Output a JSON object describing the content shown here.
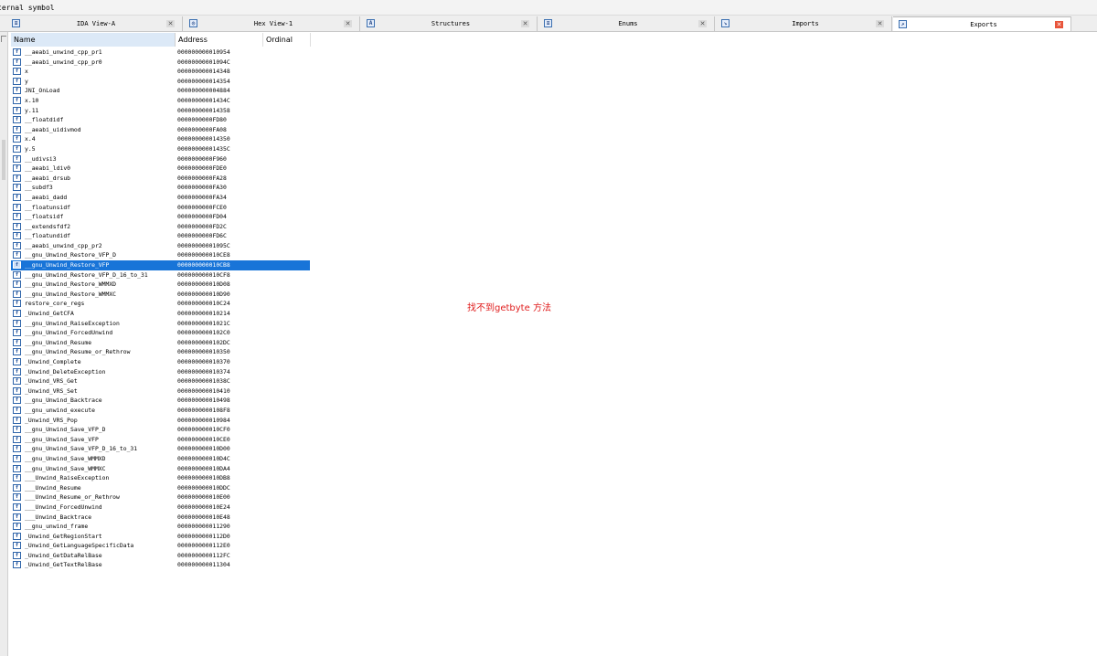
{
  "status": {
    "text": "ternal symbol"
  },
  "tabs": [
    {
      "label": "IDA View-A",
      "icon": "ida-view-icon",
      "active": false
    },
    {
      "label": "Hex View-1",
      "icon": "hex-view-icon",
      "active": false
    },
    {
      "label": "Structures",
      "icon": "structures-icon",
      "active": false
    },
    {
      "label": "Enums",
      "icon": "enums-icon",
      "active": false
    },
    {
      "label": "Imports",
      "icon": "imports-icon",
      "active": false
    },
    {
      "label": "Exports",
      "icon": "exports-icon",
      "active": true
    }
  ],
  "table": {
    "columns": {
      "name": "Name",
      "address": "Address",
      "ordinal": "Ordinal"
    },
    "selected_index": 22,
    "rows": [
      {
        "name": "__aeabi_unwind_cpp_pr1",
        "address": "000000000010954"
      },
      {
        "name": "__aeabi_unwind_cpp_pr0",
        "address": "00000000001094C"
      },
      {
        "name": "x",
        "address": "000000000014348"
      },
      {
        "name": "y",
        "address": "000000000014354"
      },
      {
        "name": "JNI_OnLoad",
        "address": "000000000004884"
      },
      {
        "name": "x.10",
        "address": "00000000001434C"
      },
      {
        "name": "y.11",
        "address": "000000000014358"
      },
      {
        "name": "__floatdidf",
        "address": "0000000000FD80"
      },
      {
        "name": "__aeabi_uidivmod",
        "address": "0000000000FA08"
      },
      {
        "name": "x.4",
        "address": "000000000014350"
      },
      {
        "name": "y.5",
        "address": "00000000001435C"
      },
      {
        "name": "__udivsi3",
        "address": "0000000000F960"
      },
      {
        "name": "__aeabi_ldiv0",
        "address": "0000000000FDE0"
      },
      {
        "name": "__aeabi_drsub",
        "address": "0000000000FA28"
      },
      {
        "name": "__subdf3",
        "address": "0000000000FA30"
      },
      {
        "name": "__aeabi_dadd",
        "address": "0000000000FA34"
      },
      {
        "name": "__floatunsidf",
        "address": "0000000000FCE0"
      },
      {
        "name": "__floatsidf",
        "address": "0000000000FD04"
      },
      {
        "name": "__extendsfdf2",
        "address": "0000000000FD2C"
      },
      {
        "name": "__floatundidf",
        "address": "0000000000FD6C"
      },
      {
        "name": "__aeabi_unwind_cpp_pr2",
        "address": "00000000001095C"
      },
      {
        "name": "__gnu_Unwind_Restore_VFP_D",
        "address": "000000000010CE8"
      },
      {
        "name": "__gnu_Unwind_Restore_VFP",
        "address": "000000000010CB8"
      },
      {
        "name": "__gnu_Unwind_Restore_VFP_D_16_to_31",
        "address": "000000000010CF8"
      },
      {
        "name": "__gnu_Unwind_Restore_WMMXD",
        "address": "000000000010D08"
      },
      {
        "name": "__gnu_Unwind_Restore_WMMXC",
        "address": "000000000010D90"
      },
      {
        "name": "restore_core_regs",
        "address": "000000000010C24"
      },
      {
        "name": "_Unwind_GetCFA",
        "address": "000000000010214"
      },
      {
        "name": "__gnu_Unwind_RaiseException",
        "address": "00000000001021C"
      },
      {
        "name": "__gnu_Unwind_ForcedUnwind",
        "address": "0000000000102C0"
      },
      {
        "name": "__gnu_Unwind_Resume",
        "address": "0000000000102DC"
      },
      {
        "name": "__gnu_Unwind_Resume_or_Rethrow",
        "address": "000000000010350"
      },
      {
        "name": "_Unwind_Complete",
        "address": "000000000010370"
      },
      {
        "name": "_Unwind_DeleteException",
        "address": "000000000010374"
      },
      {
        "name": "_Unwind_VRS_Get",
        "address": "00000000001038C"
      },
      {
        "name": "_Unwind_VRS_Set",
        "address": "000000000010410"
      },
      {
        "name": "__gnu_Unwind_Backtrace",
        "address": "000000000010498"
      },
      {
        "name": "__gnu_unwind_execute",
        "address": "0000000000108F8"
      },
      {
        "name": "_Unwind_VRS_Pop",
        "address": "000000000010984"
      },
      {
        "name": "__gnu_Unwind_Save_VFP_D",
        "address": "000000000010CF0"
      },
      {
        "name": "__gnu_Unwind_Save_VFP",
        "address": "000000000010CE0"
      },
      {
        "name": "__gnu_Unwind_Save_VFP_D_16_to_31",
        "address": "000000000010D00"
      },
      {
        "name": "__gnu_Unwind_Save_WMMXD",
        "address": "000000000010D4C"
      },
      {
        "name": "__gnu_Unwind_Save_WMMXC",
        "address": "000000000010DA4"
      },
      {
        "name": "___Unwind_RaiseException",
        "address": "000000000010DB8"
      },
      {
        "name": "___Unwind_Resume",
        "address": "000000000010DDC"
      },
      {
        "name": "___Unwind_Resume_or_Rethrow",
        "address": "000000000010E00"
      },
      {
        "name": "___Unwind_ForcedUnwind",
        "address": "000000000010E24"
      },
      {
        "name": "___Unwind_Backtrace",
        "address": "000000000010E48"
      },
      {
        "name": "__gnu_unwind_frame",
        "address": "000000000011290"
      },
      {
        "name": "_Unwind_GetRegionStart",
        "address": "0000000000112D0"
      },
      {
        "name": "_Unwind_GetLanguageSpecificData",
        "address": "0000000000112E0"
      },
      {
        "name": "_Unwind_GetDataRelBase",
        "address": "0000000000112FC"
      },
      {
        "name": "_Unwind_GetTextRelBase",
        "address": "000000000011304"
      }
    ]
  },
  "annotation": {
    "text": "找不到getbyte 方法",
    "color": "#e01e1e"
  },
  "colors": {
    "selection": "#1874d8",
    "header_active": "#dce9f7",
    "tab_close_active": "#e8543a"
  }
}
